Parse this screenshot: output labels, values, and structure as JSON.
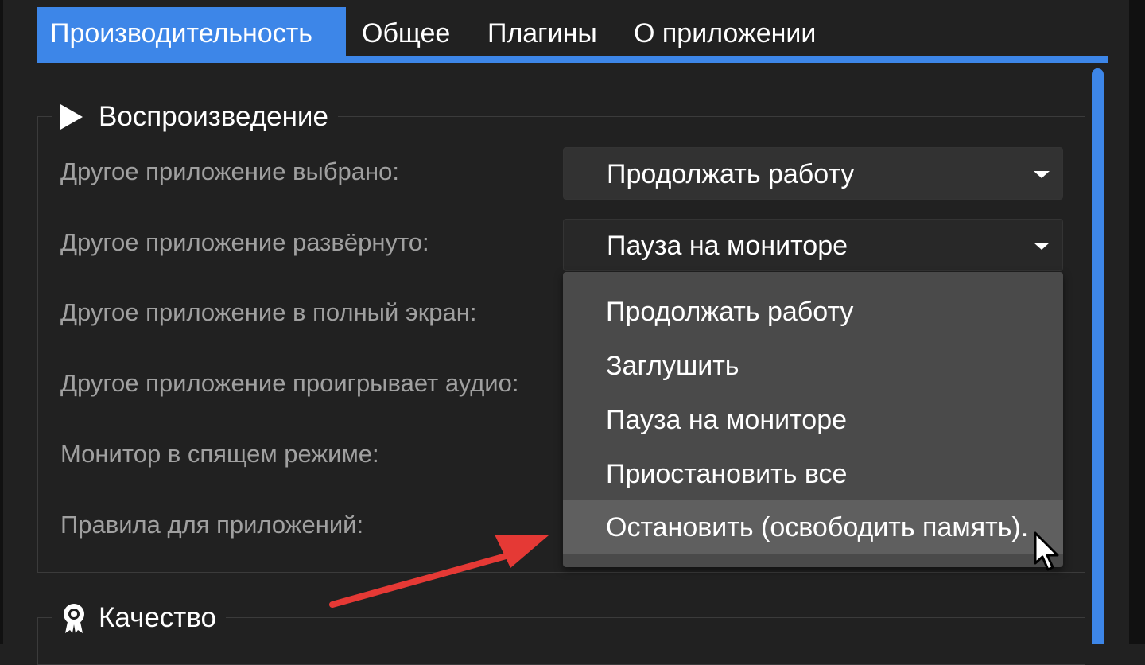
{
  "tabs": [
    {
      "label": "Производительность",
      "active": true
    },
    {
      "label": "Общее",
      "active": false
    },
    {
      "label": "Плагины",
      "active": false
    },
    {
      "label": "О приложении",
      "active": false
    }
  ],
  "playback": {
    "title": "Воспроизведение",
    "icon": "play-icon",
    "rows": [
      {
        "label": "Другое приложение выбрано:",
        "value": "Продолжать работу"
      },
      {
        "label": "Другое приложение развёрнуто:",
        "value": "Пауза на мониторе"
      },
      {
        "label": "Другое приложение в полный экран:"
      },
      {
        "label": "Другое приложение проигрывает аудио:"
      },
      {
        "label": "Монитор в спящем режиме:"
      },
      {
        "label": "Правила для приложений:"
      }
    ]
  },
  "dropdown": {
    "options": [
      "Продолжать работу",
      "Заглушить",
      "Пауза на мониторе",
      "Приостановить все",
      "Остановить (освободить память)."
    ],
    "hovered_index": 4
  },
  "quality": {
    "title": "Качество",
    "icon": "award-icon"
  },
  "colors": {
    "accent": "#3d86e8",
    "background": "#212121",
    "annotation_arrow": "#e53935"
  }
}
